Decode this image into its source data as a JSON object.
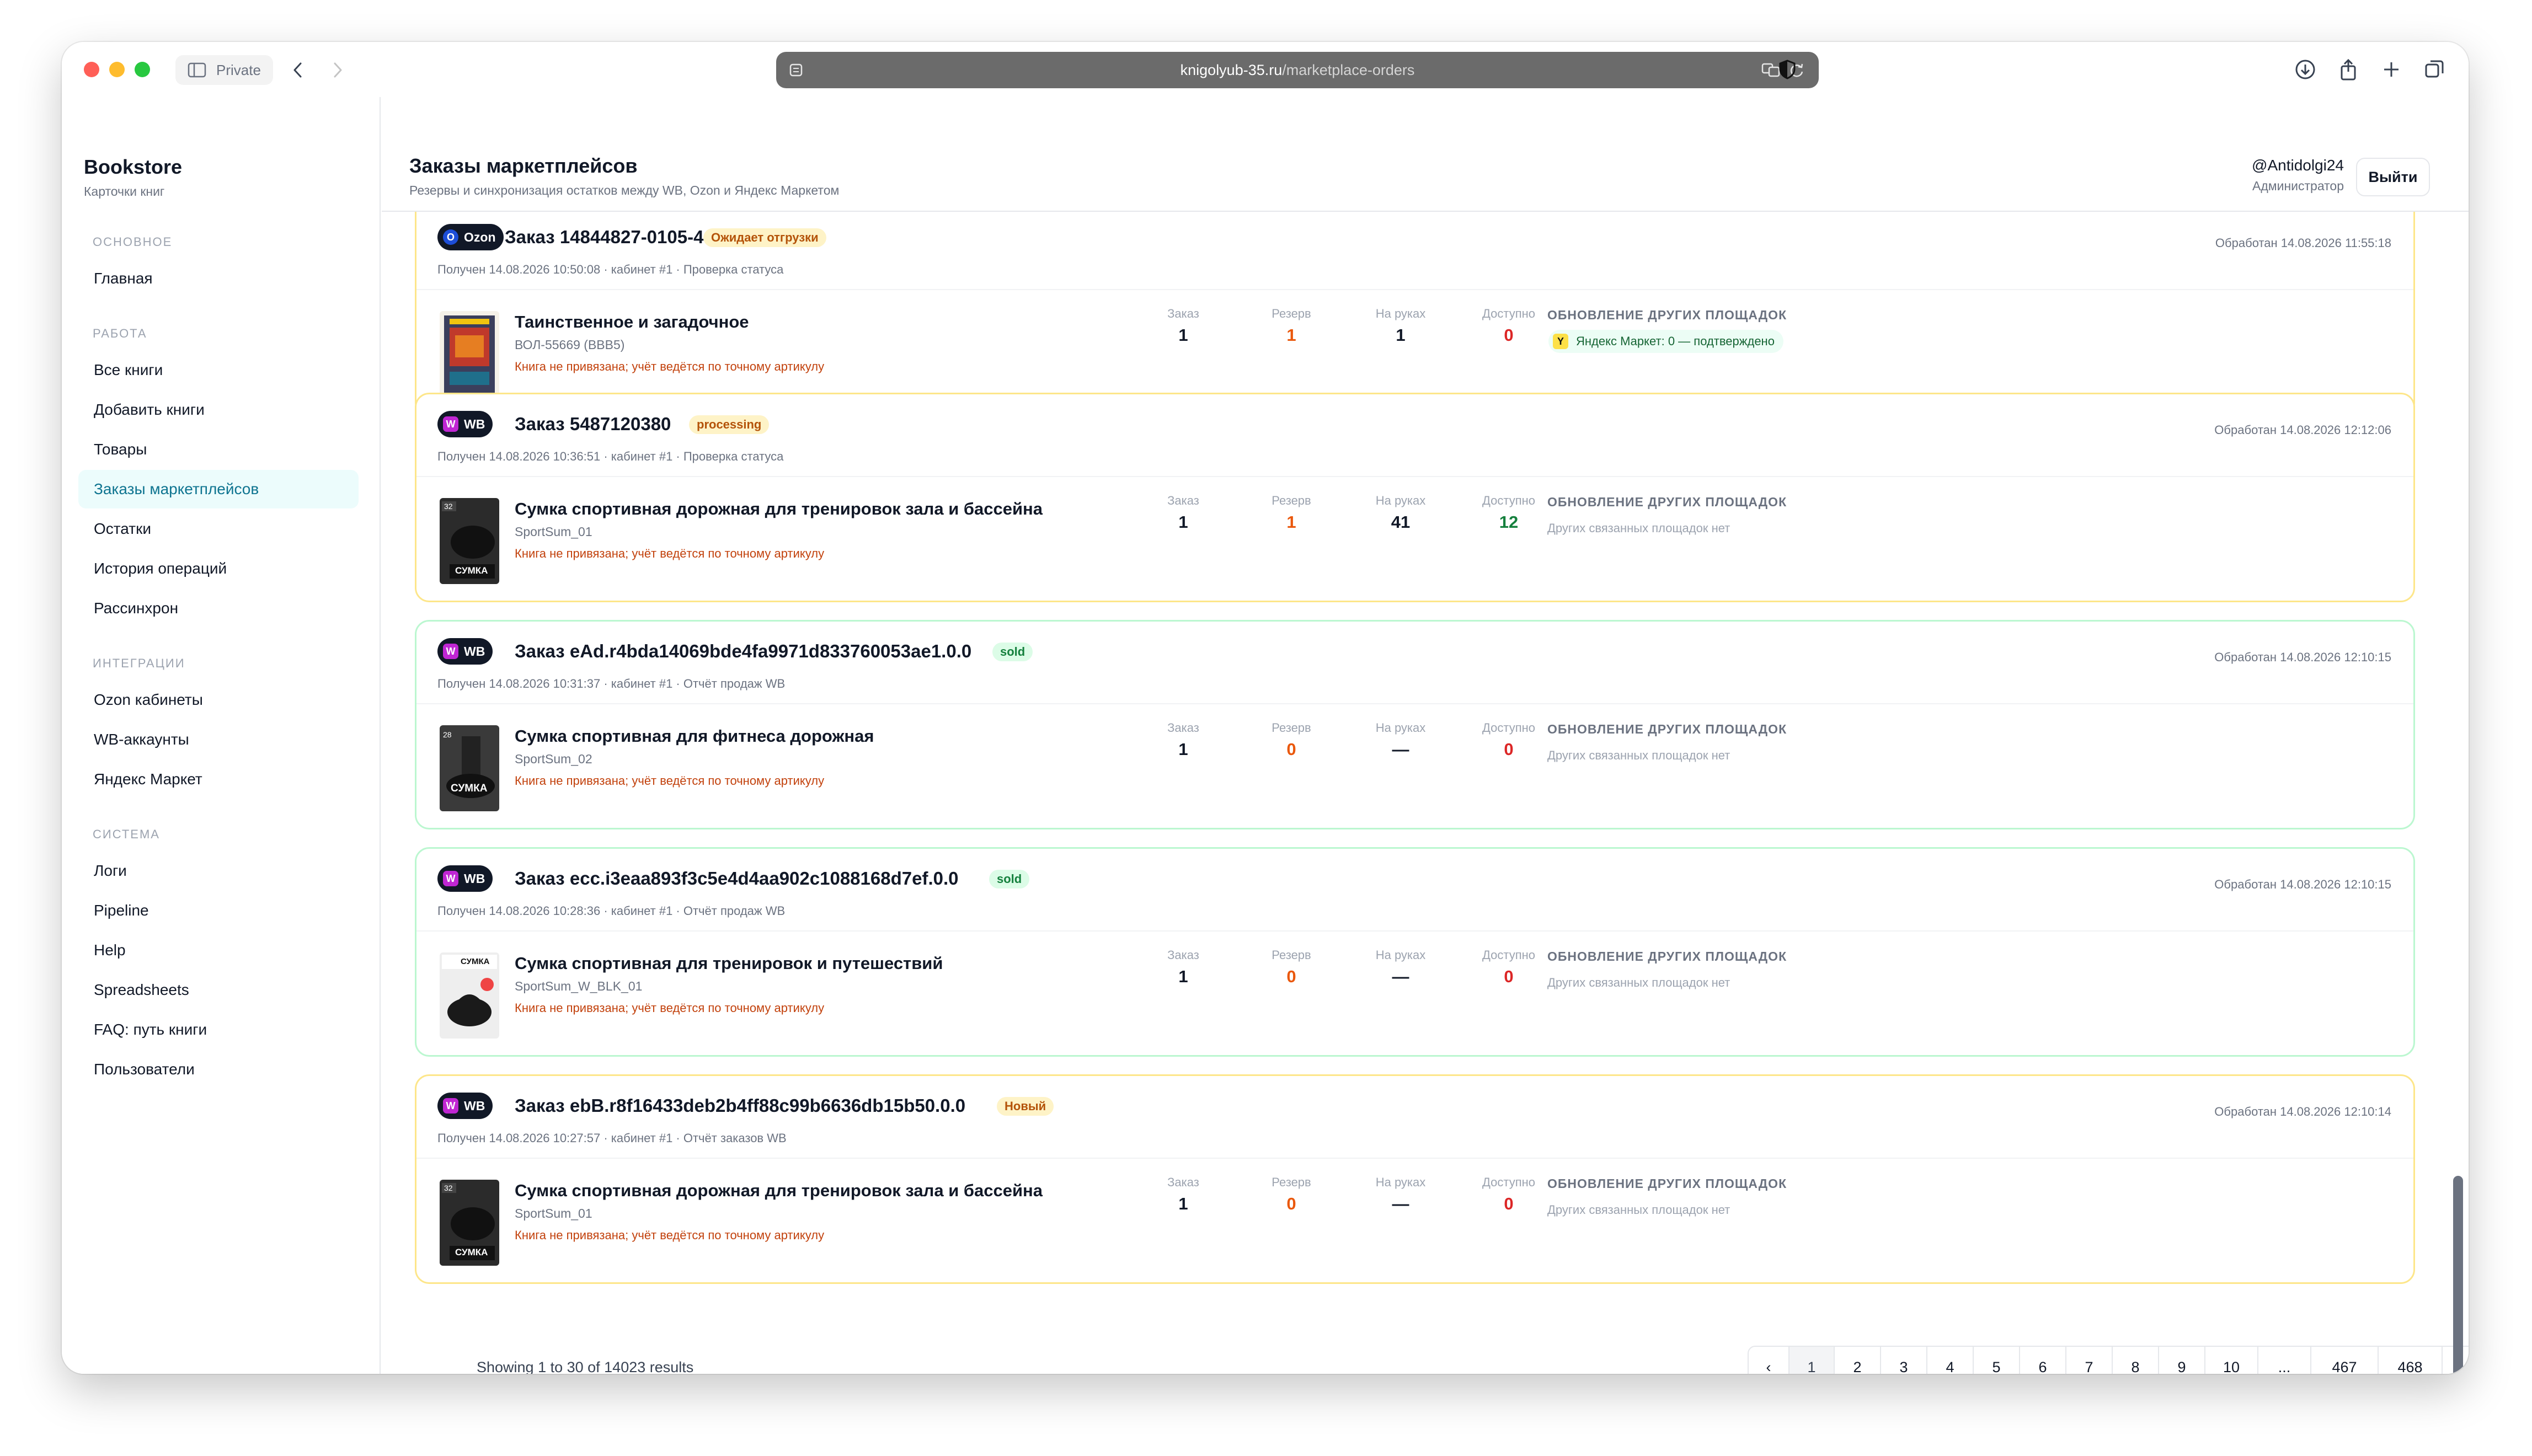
{
  "browser": {
    "private_label": "Private",
    "url_host": "knigolyub-35.ru",
    "url_path": "/marketplace-orders"
  },
  "sidebar": {
    "brand_title": "Bookstore",
    "brand_subtitle": "Карточки книг",
    "sections": [
      {
        "title": "ОСНОВНОЕ",
        "items": [
          {
            "label": "Главная"
          }
        ]
      },
      {
        "title": "РАБОТА",
        "items": [
          {
            "label": "Все книги"
          },
          {
            "label": "Добавить книги"
          },
          {
            "label": "Товары"
          },
          {
            "label": "Заказы маркетплейсов",
            "active": true
          },
          {
            "label": "Остатки"
          },
          {
            "label": "История операций"
          },
          {
            "label": "Рассинхрон"
          }
        ]
      },
      {
        "title": "ИНТЕГРАЦИИ",
        "items": [
          {
            "label": "Ozon кабинеты"
          },
          {
            "label": "WB-аккаунты"
          },
          {
            "label": "Яндекс Маркет"
          }
        ]
      },
      {
        "title": "СИСТЕМА",
        "items": [
          {
            "label": "Логи"
          },
          {
            "label": "Pipeline"
          },
          {
            "label": "Help"
          },
          {
            "label": "Spreadsheets"
          },
          {
            "label": "FAQ: путь книги"
          },
          {
            "label": "Пользователи"
          }
        ]
      }
    ]
  },
  "header": {
    "title": "Заказы маркетплейсов",
    "subtitle": "Резервы и синхронизация остатков между WB, Ozon и Яндекс Маркетом",
    "user_name": "@Antidolgi24",
    "user_role": "Администратор",
    "logout_label": "Выйти"
  },
  "stat_labels": {
    "order": "Заказ",
    "reserve": "Резерв",
    "on_hand": "На руках",
    "available": "Доступно"
  },
  "sync_header": "ОБНОВЛЕНИЕ ДРУГИХ ПЛОЩАДОК",
  "orders": [
    {
      "marketplace": "Ozon",
      "order_title": "Заказ 14844827-0105-4",
      "status": "Ожидает отгрузки",
      "meta": "Получен 14.08.2026 10:50:08 · кабинет #1 · Проверка статуса",
      "processed": "Обработан 14.08.2026 11:55:18",
      "product_title": "Таинственное и загадочное",
      "sku": "ВОЛ-55669 (BBB5)",
      "warning": "Книга не привязана; учёт ведётся по точному артикулу",
      "order_qty": "1",
      "reserve": "1",
      "on_hand": "1",
      "available": "0",
      "sync_note": "",
      "sync_pill": "Яндекс Маркет: 0 — подтверждено",
      "sync_pill_icon": "Y",
      "thumb_label": ""
    },
    {
      "marketplace": "WB",
      "order_title": "Заказ 5487120380",
      "status": "processing",
      "meta": "Получен 14.08.2026 10:36:51 · кабинет #1 · Проверка статуса",
      "processed": "Обработан 14.08.2026 12:12:06",
      "product_title": "Сумка спортивная дорожная для тренировок зала и бассейна",
      "sku": "SportSum_01",
      "warning": "Книга не привязана; учёт ведётся по точному артикулу",
      "order_qty": "1",
      "reserve": "1",
      "on_hand": "41",
      "available": "12",
      "sync_note": "Других связанных площадок нет",
      "thumb_label": "СУМКА"
    },
    {
      "marketplace": "WB",
      "order_title": "Заказ eAd.r4bda14069bde4fa9971d833760053ae1.0.0",
      "status": "sold",
      "meta": "Получен 14.08.2026 10:31:37 · кабинет #1 · Отчёт продаж WB",
      "processed": "Обработан 14.08.2026 12:10:15",
      "product_title": "Сумка спортивная для фитнеса дорожная",
      "sku": "SportSum_02",
      "warning": "Книга не привязана; учёт ведётся по точному артикулу",
      "order_qty": "1",
      "reserve": "0",
      "on_hand": "—",
      "available": "0",
      "sync_note": "Других связанных площадок нет",
      "thumb_label": "СУМКА"
    },
    {
      "marketplace": "WB",
      "order_title": "Заказ ecc.i3eaa893f3c5e4d4aa902c1088168d7ef.0.0",
      "status": "sold",
      "meta": "Получен 14.08.2026 10:28:36 · кабинет #1 · Отчёт продаж WB",
      "processed": "Обработан 14.08.2026 12:10:15",
      "product_title": "Сумка спортивная для тренировок и путешествий",
      "sku": "SportSum_W_BLK_01",
      "warning": "Книга не привязана; учёт ведётся по точному артикулу",
      "order_qty": "1",
      "reserve": "0",
      "on_hand": "—",
      "available": "0",
      "sync_note": "Других связанных площадок нет",
      "thumb_label": "СУМКА"
    },
    {
      "marketplace": "WB",
      "order_title": "Заказ ebB.r8f16433deb2b4ff88c99b6636db15b50.0.0",
      "status": "Новый",
      "meta": "Получен 14.08.2026 10:27:57 · кабинет #1 · Отчёт заказов WB",
      "processed": "Обработан 14.08.2026 12:10:14",
      "product_title": "Сумка спортивная дорожная для тренировок зала и бассейна",
      "sku": "SportSum_01",
      "warning": "Книга не привязана; учёт ведётся по точному артикулу",
      "order_qty": "1",
      "reserve": "0",
      "on_hand": "—",
      "available": "0",
      "sync_note": "Других связанных площадок нет",
      "thumb_label": "СУМКА"
    }
  ],
  "pagination": {
    "results_text": "Showing 1 to 30 of 14023 results",
    "prev_icon": "‹",
    "next_icon": "›",
    "pages": [
      "1",
      "2",
      "3",
      "4",
      "5",
      "6",
      "7",
      "8",
      "9",
      "10",
      "...",
      "467",
      "468"
    ],
    "current": "1"
  },
  "colors": {
    "accent": "#0e7490",
    "amber_border": "#fde68a",
    "green_border": "#bbf7d0",
    "warning": "#c2410c",
    "reserve": "#ea580c",
    "zero_available": "#dc2626",
    "positive_available": "#15803d",
    "wb_brand": "#c026d3",
    "ozon_brand": "#1d4ed8"
  }
}
